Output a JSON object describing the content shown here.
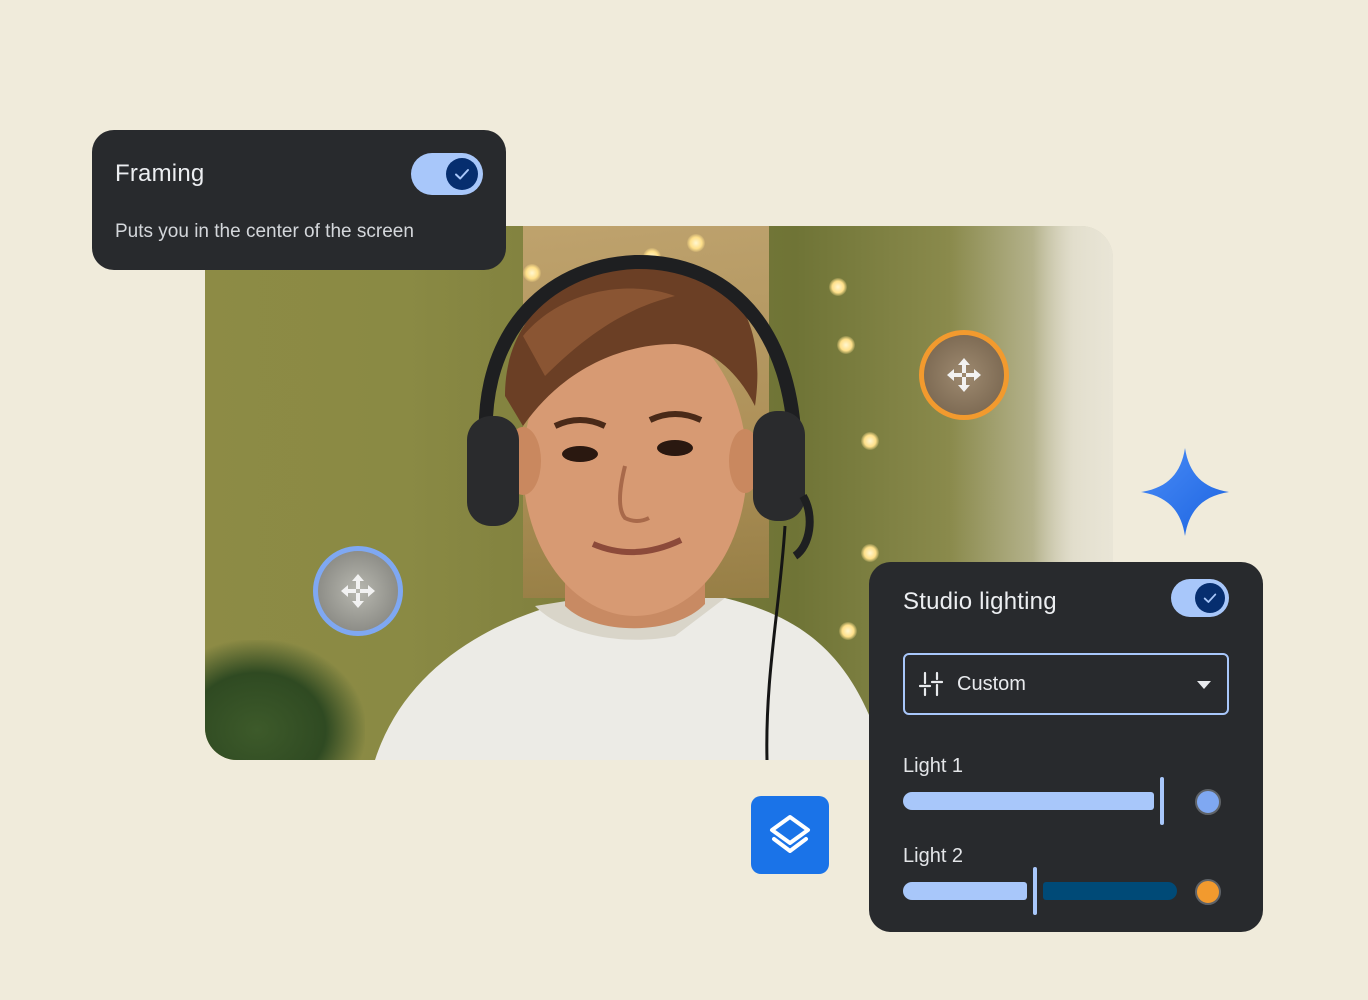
{
  "framing": {
    "title": "Framing",
    "subtitle": "Puts you in the center of the screen",
    "enabled": true
  },
  "studio_lighting": {
    "title": "Studio lighting",
    "enabled": true,
    "preset": {
      "selected": "Custom",
      "icon": "tune-sliders-icon"
    },
    "lights": [
      {
        "label": "Light 1",
        "level": 0.96,
        "color": "#7fa8f2"
      },
      {
        "label": "Light 2",
        "level": 0.48,
        "color": "#f29a2e"
      }
    ]
  },
  "colors": {
    "background": "#f0ebdb",
    "card": "#282a2d",
    "accent": "#a8c7fa",
    "accent_dark": "#062e6f",
    "brand_blue": "#1a73e8",
    "handle_blue": "#7fa8f2",
    "handle_orange": "#f29a2e"
  },
  "icons": {
    "handles": [
      "move-arrows-icon",
      "move-arrows-icon"
    ],
    "floating": [
      "layers-icon",
      "sparkle-icon"
    ]
  }
}
